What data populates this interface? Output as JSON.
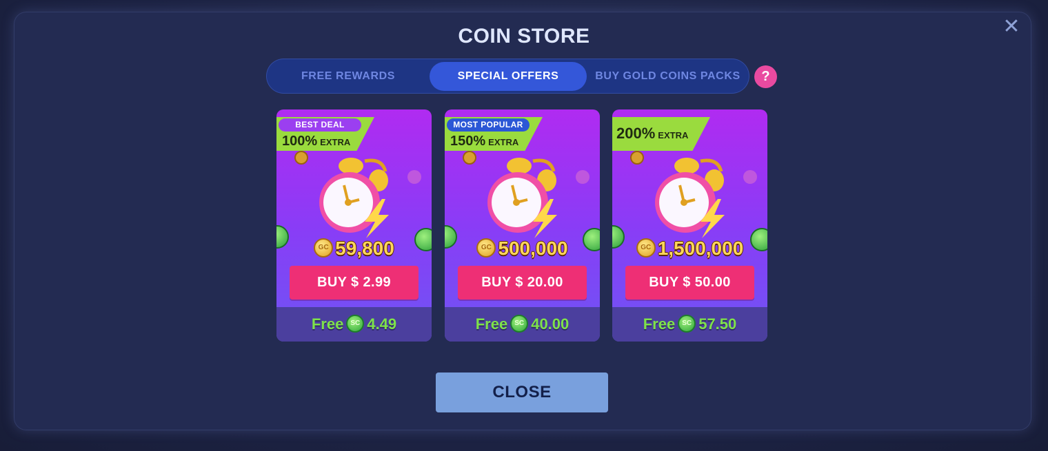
{
  "title": "COIN STORE",
  "tabs": [
    {
      "label": "FREE REWARDS",
      "active": false
    },
    {
      "label": "SPECIAL OFFERS",
      "active": true
    },
    {
      "label": "BUY GOLD COINS PACKS",
      "active": false
    }
  ],
  "help_label": "?",
  "close_x": "✕",
  "coin_labels": {
    "gc": "GC",
    "sc": "SC"
  },
  "offers": [
    {
      "badge": "BEST DEAL",
      "extra_pct": "100%",
      "extra_label": "EXTRA",
      "amount": "59,800",
      "buy_label": "BUY $ 2.99",
      "free_label": "Free",
      "free_value": "4.49"
    },
    {
      "badge": "MOST POPULAR",
      "extra_pct": "150%",
      "extra_label": "EXTRA",
      "amount": "500,000",
      "buy_label": "BUY $ 20.00",
      "free_label": "Free",
      "free_value": "40.00"
    },
    {
      "badge": "",
      "extra_pct": "200%",
      "extra_label": "EXTRA",
      "amount": "1,500,000",
      "buy_label": "BUY $ 50.00",
      "free_label": "Free",
      "free_value": "57.50"
    }
  ],
  "close_button": "CLOSE",
  "colors": {
    "modal_bg": "#232b52",
    "active_tab": "#3457d9",
    "buy_button": "#ee2f75",
    "ribbon": "#9adb3e",
    "free_text": "#7ee24a",
    "close_button": "#79a0dd"
  }
}
